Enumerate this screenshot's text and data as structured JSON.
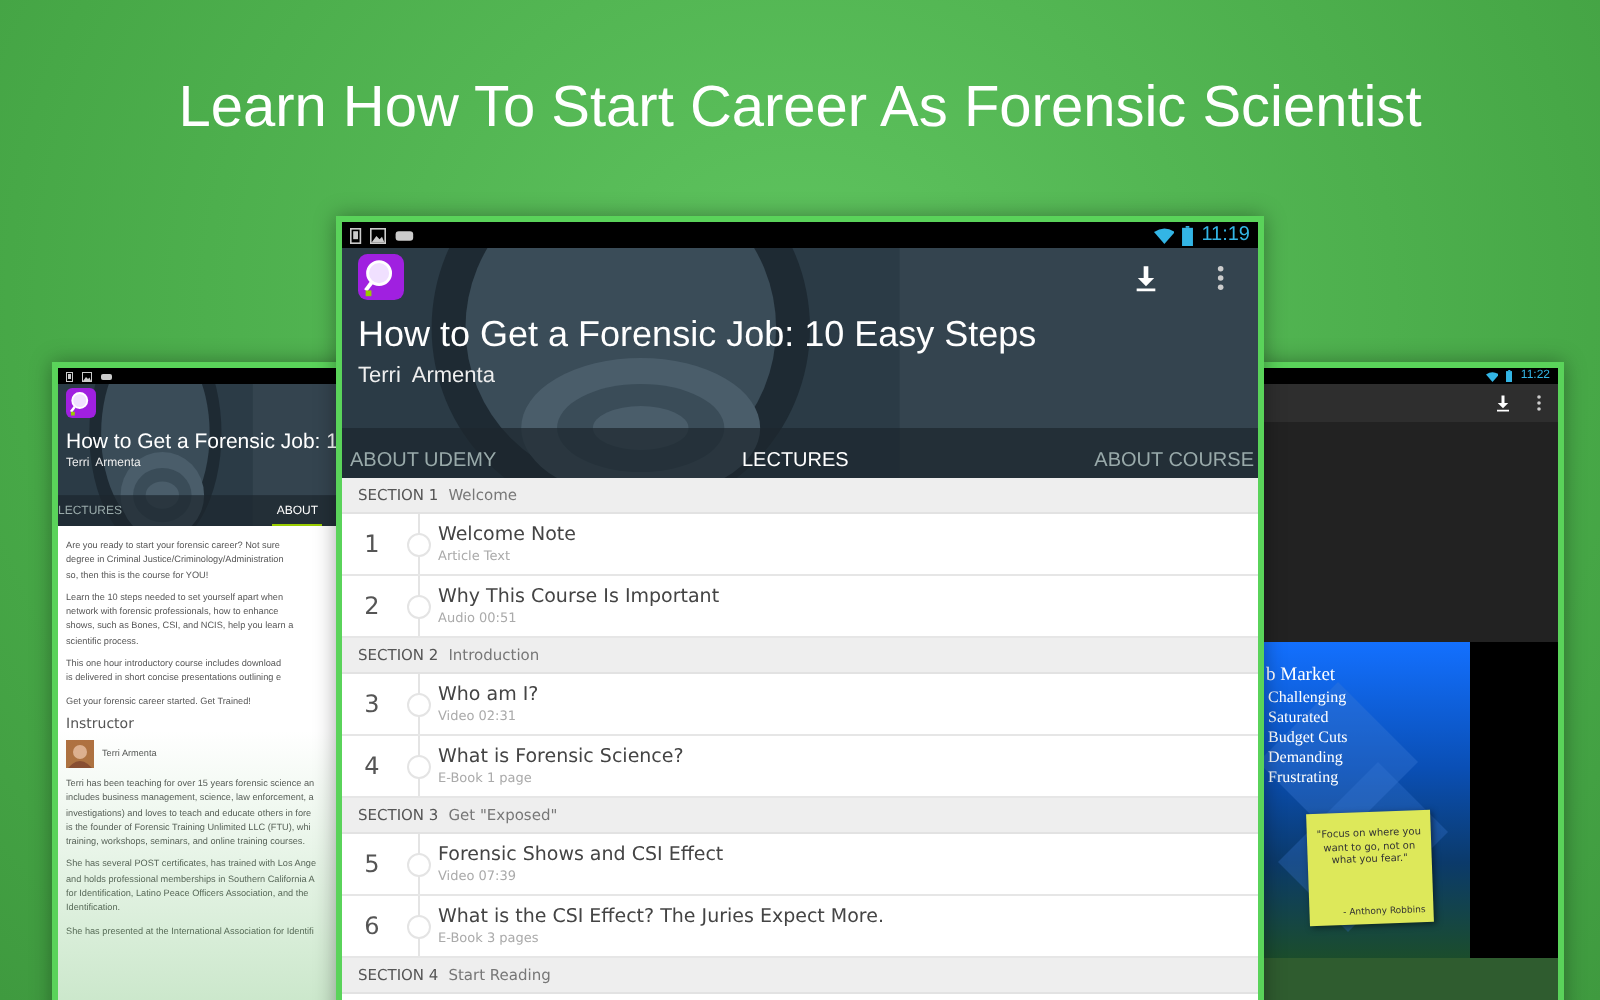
{
  "headline": "Learn How To Start Career As Forensic Scientist",
  "left_tablet": {
    "course_title": "How to Get a Forensic Job: 1",
    "instructor": "Terri  Armenta",
    "tabs": [
      {
        "label": "LECTURES",
        "selected": false
      },
      {
        "label": "ABOUT",
        "selected": true
      }
    ],
    "paragraphs": [
      "Are you ready to start your forensic career? Not sure\ndegree in Criminal Justice/Criminology/Administration\nso, then this is the course for YOU!",
      "Learn the 10 steps needed to set yourself apart when\nnetwork with forensic professionals, how to enhance\nshows, such as Bones, CSI, and NCIS, help you learn a\nscientific process.",
      "This one hour introductory course includes download\nis delivered in short concise presentations outlining e",
      "Get your forensic career started. Get Trained!"
    ],
    "instructor_heading": "Instructor",
    "instructor_name": "Terri Armenta",
    "bio": [
      "Terri has been teaching for over 15 years forensic science an\nincludes business management, science, law enforcement, a\ninvestigations) and loves to teach and educate others in fore\nis the founder of Forensic Training Unlimited LLC (FTU), whi\ntraining, workshops, seminars, and online training courses.",
      "She has several POST certificates, has trained with Los Ange\nand holds professional memberships in Southern California A\nfor Identification, Latino Peace Officers Association, and the\nIdentification.",
      "She has presented at the International Association for Identifi"
    ]
  },
  "center_tablet": {
    "status_time": "11:19",
    "course_title": "How to Get a Forensic Job: 10 Easy Steps",
    "instructor": "Terri  Armenta",
    "tabs": [
      {
        "label": "ABOUT UDEMY",
        "selected": false
      },
      {
        "label": "LECTURES",
        "selected": true
      },
      {
        "label": "ABOUT COURSE",
        "selected": false
      }
    ],
    "sections": [
      {
        "label": "SECTION 1",
        "title": "Welcome",
        "lectures": [
          {
            "number": "1",
            "title": "Welcome Note",
            "meta": "Article Text"
          },
          {
            "number": "2",
            "title": "Why This Course Is Important",
            "meta": "Audio 00:51"
          }
        ]
      },
      {
        "label": "SECTION 2",
        "title": "Introduction",
        "lectures": [
          {
            "number": "3",
            "title": "Who am I?",
            "meta": "Video 02:31"
          },
          {
            "number": "4",
            "title": "What is Forensic Science?",
            "meta": "E-Book 1 page"
          }
        ]
      },
      {
        "label": "SECTION 3",
        "title": "Get \"Exposed\"",
        "lectures": [
          {
            "number": "5",
            "title": "Forensic Shows and CSI Effect",
            "meta": "Video 07:39"
          },
          {
            "number": "6",
            "title": "What is the CSI Effect? The Juries Expect More.",
            "meta": "E-Book 3 pages"
          }
        ]
      },
      {
        "label": "SECTION 4",
        "title": "Start Reading"
      }
    ]
  },
  "right_tablet": {
    "status_time": "11:22",
    "slide": {
      "heading": "b Market",
      "bullets": [
        "Challenging",
        "Saturated",
        "Budget Cuts",
        "Demanding",
        "Frustrating"
      ],
      "note": "\"Focus on where you want to go, not on what you fear.\"",
      "note_author": "- Anthony Robbins"
    }
  }
}
